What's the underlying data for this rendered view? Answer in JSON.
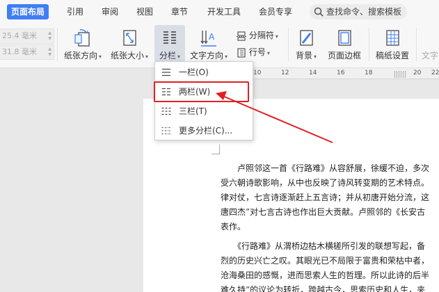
{
  "tabs": [
    {
      "label": "页面布局",
      "active": true
    },
    {
      "label": "引用",
      "active": false
    },
    {
      "label": "审阅",
      "active": false
    },
    {
      "label": "视图",
      "active": false
    },
    {
      "label": "章节",
      "active": false
    },
    {
      "label": "开发工具",
      "active": false
    },
    {
      "label": "会员专享",
      "active": false
    }
  ],
  "search": {
    "placeholder": "查找命令、搜索模板"
  },
  "ribbon": {
    "margin_top": "25.4 毫米",
    "margin_bottom": "31.8 毫米",
    "orientation_label": "纸张方向",
    "size_label": "纸张大小",
    "columns_label": "分栏",
    "text_direction_label": "文字方向",
    "separator_label": "分隔符",
    "line_number_label": "行号",
    "background_label": "背景",
    "page_border_label": "页面边框",
    "paper_settings_label": "稿纸设置",
    "text_cut_label": "文字"
  },
  "ruler": {
    "numbers": [
      "10",
      "12",
      "14",
      "16",
      "18",
      "20",
      "22"
    ]
  },
  "columns_menu": {
    "items": [
      {
        "label": "一栏(O)"
      },
      {
        "label": "两栏(W)"
      },
      {
        "label": "三栏(T)"
      },
      {
        "label": "更多分栏(C)..."
      }
    ],
    "highlighted_index": 1
  },
  "document": {
    "paragraph1": [
      "　　卢照邻这一首《行路难》从容舒展，徐缓不迫，多次",
      "受六朝诗歌影响，从中也反映了诗风转变期的艺术特点。",
      "律对仗，七言诗逐渐赶上五言诗；并从初唐开始分流，这",
      "唐四杰”对七言古诗也作出巨大贡献。卢照邻的《长安古",
      "表作。"
    ],
    "paragraph2": [
      "　　《行路难》从渭桥边枯木横槎所引发的联想写起，备",
      "烈的历史兴亡之叹。其眼光已不局限于富贵和荣枯中者，",
      "沧海桑田的感慨，进而思索人生的哲理。所以此诗的后半",
      "难久持”的议论为转折，跨越古今，思索历史和人生，夹"
    ]
  },
  "colors": {
    "accent": "#3f7ef5",
    "annotation": "#e02020"
  }
}
